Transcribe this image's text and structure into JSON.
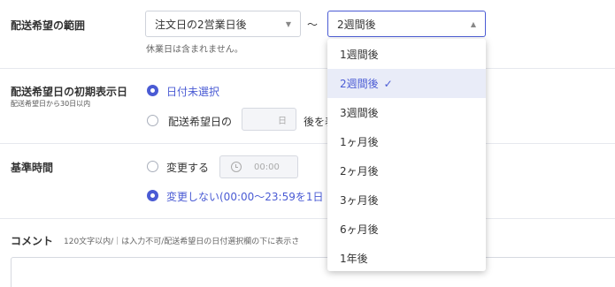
{
  "delivery_range": {
    "label": "配送希望の範囲",
    "from_value": "注文日の2営業日後",
    "separator": "～",
    "to_value": "2週間後",
    "note": "休業日は含まれません。"
  },
  "initial_display": {
    "label": "配送希望日の初期表示日",
    "sublabel": "配送希望日から30日以内",
    "option_unselected": "日付未選択",
    "option_delivery_prefix": "配送希望日の",
    "days_unit": "日",
    "option_delivery_suffix": "後を表"
  },
  "base_time": {
    "label": "基準時間",
    "option_change": "変更する",
    "time_placeholder": "00:00",
    "option_no_change": "変更しない(00:00～23:59を1日"
  },
  "comment": {
    "label": "コメント",
    "hint": "120文字以内/｜は入力不可/配送希望日の日付選択欄の下に表示さ"
  },
  "dropdown": {
    "options": [
      "1週間後",
      "2週間後",
      "3週間後",
      "1ヶ月後",
      "2ヶ月後",
      "3ヶ月後",
      "6ヶ月後",
      "1年後"
    ],
    "selected_index": 1
  },
  "colors": {
    "accent": "#4a5bd4"
  }
}
